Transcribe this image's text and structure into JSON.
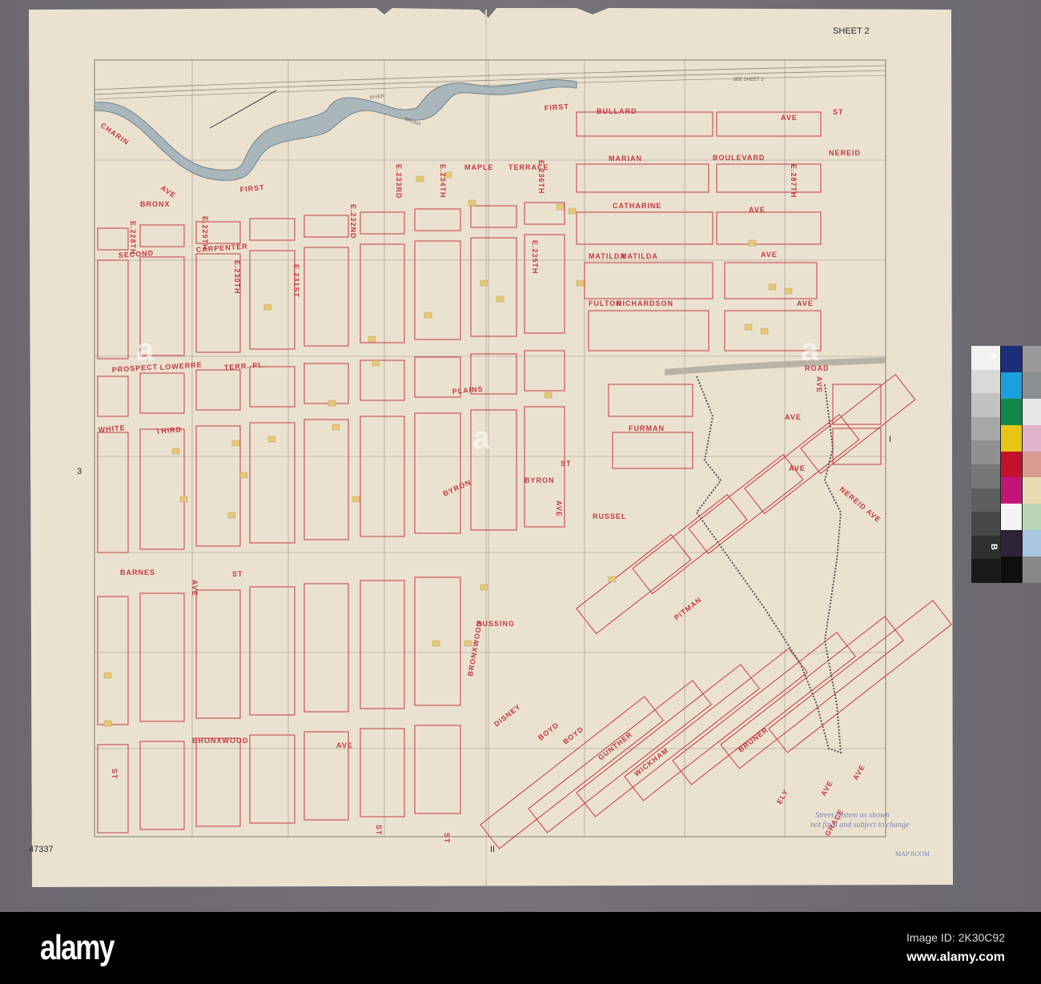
{
  "sheet": {
    "title": "SHEET 2",
    "see_sheet": "SEE SHEET 3",
    "catalog_number": "47337",
    "margin_left": "3",
    "margin_right": "I",
    "margin_bottom": "II",
    "stamp": "MAP ROOM",
    "note_line1": "Street System as shown",
    "note_line2": "not final and subject to change"
  },
  "water": {
    "river_word1": "BRONX",
    "river_word2": "RIVER"
  },
  "streets": [
    "BULLARD",
    "AVE",
    "FIRST",
    "ST",
    "BOULEVARD",
    "NEREID",
    "E.287TH",
    "MAPLE",
    "TERRACE",
    "MARIAN",
    "CHARIN",
    "AVE",
    "BRONX",
    "FIRST",
    "E.228TH",
    "E.229TH",
    "E.232ND",
    "E.233RD",
    "E.234TH",
    "E.236TH",
    "CATHARINE",
    "AVE",
    "SECOND",
    "CARPENTER",
    "E.230TH",
    "E.231ST",
    "E.235TH",
    "MATILDA",
    "MATILDA",
    "AVE",
    "FULTON",
    "RICHARDSON",
    "AVE",
    "PROSPECT",
    "LOWERRE",
    "TERR. PL.",
    "PLAINS",
    "ROAD",
    "WHITE",
    "THIRD",
    "FURMAN",
    "AVE",
    "AVE",
    "AVE",
    "BYRON",
    "BYRON",
    "RUSSEL",
    "ST",
    "NEREID AVE",
    "BARNES",
    "ST",
    "BUSSING",
    "BRONXWOOD",
    "AVE",
    "DISNEY",
    "BOYD",
    "BOYD",
    "GUNTHER",
    "WICKHAM",
    "BRUNER",
    "ELY",
    "AVE",
    "AVE",
    "GRACE",
    "PITMAN",
    "BRONXWOOD",
    "AVE",
    "ST",
    "ST",
    "ST",
    "AVE"
  ],
  "color_strip": {
    "label_a": "A",
    "label_b": "B",
    "gray": [
      "#f2f2f2",
      "#d9d9d9",
      "#c2c2c2",
      "#a8a8a8",
      "#909090",
      "#777",
      "#5e5e5e",
      "#474747",
      "#2f2f2f",
      "#1a1a1a"
    ],
    "colors": [
      "#1c2d7a",
      "#1aa0dc",
      "#12884a",
      "#e6c613",
      "#c4112c",
      "#c4147a",
      "#f4f4f4",
      "#2e2438",
      "#0f0f0f"
    ],
    "tints": [
      "#9a9a9a",
      "#8d9090",
      "#e6e6e6",
      "#e0b3cc",
      "#d99a90",
      "#e8dcb3",
      "#b8d6b3",
      "#a8c6e0",
      "#888"
    ]
  },
  "watermark": {
    "logo": "alamy",
    "image_id": "Image ID: 2K30C92",
    "url": "www.alamy.com"
  },
  "colors": {
    "paper": "#ebe1cf",
    "street_red": "#c23a43",
    "river": "#a9b7bd",
    "building": "#e7c77a"
  }
}
